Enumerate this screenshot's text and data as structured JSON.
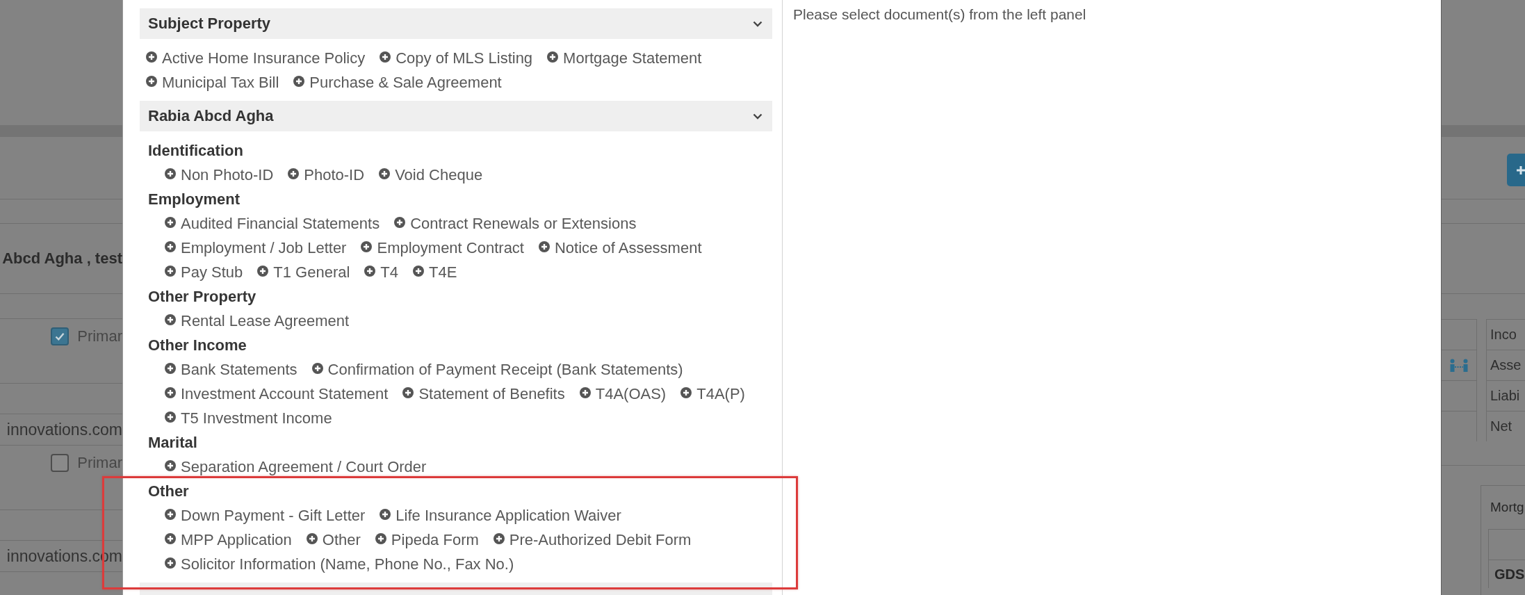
{
  "background_page": {
    "applicant": "Abcd Agha , test",
    "contacts": [
      {
        "primary": true,
        "label": "Primar",
        "email": "innovations.com"
      },
      {
        "primary": false,
        "label": "Primar",
        "email": "innovations.com"
      }
    ],
    "summary_rows": [
      {
        "kind": "plain",
        "label": "Inco"
      },
      {
        "kind": "linked",
        "label": "Asse"
      },
      {
        "kind": "plain",
        "label": "Liabi"
      },
      {
        "kind": "plain",
        "label": "Net"
      }
    ],
    "mortgage_panel": {
      "title": "Mortg",
      "row_label": "GDS"
    }
  },
  "dialog": {
    "sections": [
      {
        "title": "Subject Property",
        "expanded": true,
        "documents": [
          "Active Home Insurance Policy",
          "Copy of MLS Listing",
          "Mortgage Statement",
          "Municipal Tax Bill",
          "Purchase & Sale Agreement"
        ]
      },
      {
        "title": "Rabia Abcd Agha",
        "expanded": true,
        "groups": [
          {
            "title": "Identification",
            "highlighted": false,
            "documents": [
              "Non Photo-ID",
              "Photo-ID",
              "Void Cheque"
            ]
          },
          {
            "title": "Employment",
            "highlighted": false,
            "documents": [
              "Audited Financial Statements",
              "Contract Renewals or Extensions",
              "Employment / Job Letter",
              "Employment Contract",
              "Notice of Assessment",
              "Pay Stub",
              "T1 General",
              "T4",
              "T4E"
            ]
          },
          {
            "title": "Other Property",
            "highlighted": false,
            "documents": [
              "Rental Lease Agreement"
            ]
          },
          {
            "title": "Other Income",
            "highlighted": false,
            "documents": [
              "Bank Statements",
              "Confirmation of Payment Receipt (Bank Statements)",
              "Investment Account Statement",
              "Statement of Benefits",
              "T4A(OAS)",
              "T4A(P)",
              "T5 Investment Income"
            ]
          },
          {
            "title": "Marital",
            "highlighted": false,
            "documents": [
              "Separation Agreement / Court Order"
            ]
          },
          {
            "title": "Other",
            "highlighted": true,
            "documents": [
              "Down Payment - Gift Letter",
              "Life Insurance Application Waiver",
              "MPP Application",
              "Other",
              "Pipeda Form",
              "Pre-Authorized Debit Form",
              "Solicitor Information (Name, Phone No., Fax No.)"
            ]
          }
        ]
      }
    ],
    "preview_message": "Please select document(s) from the left panel"
  }
}
